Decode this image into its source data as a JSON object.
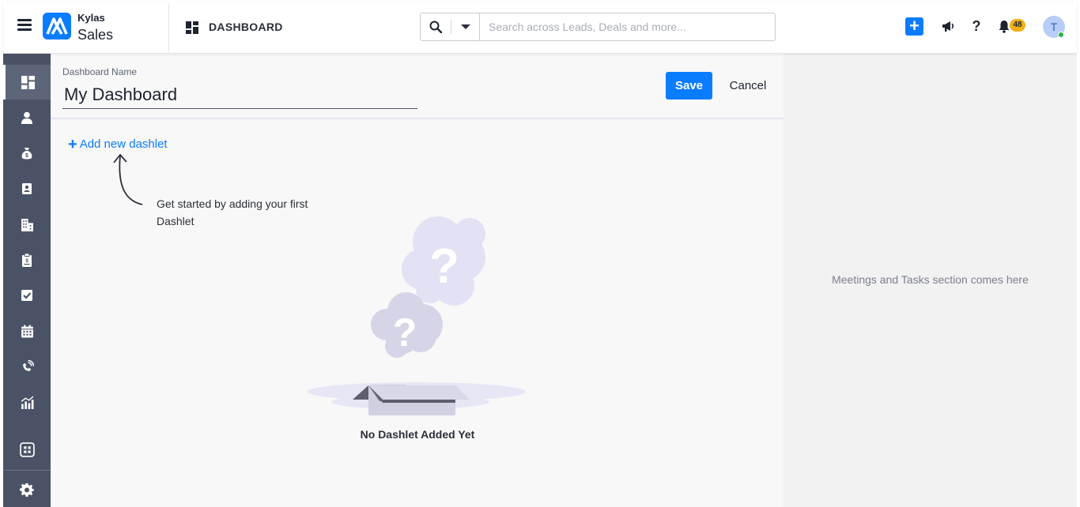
{
  "header": {
    "brand_top": "Kylas",
    "brand_bottom": "Sales",
    "page_title": "DASHBOARD",
    "search_placeholder": "Search across Leads, Deals and more...",
    "notifications_count": "48",
    "avatar_initial": "T",
    "help_label": "?"
  },
  "sidebar": {
    "items": [
      {
        "icon": "dashboard-icon"
      },
      {
        "icon": "contacts-person-icon"
      },
      {
        "icon": "money-bag-icon"
      },
      {
        "icon": "contact-card-icon"
      },
      {
        "icon": "company-building-icon"
      },
      {
        "icon": "deal-clipboard-icon"
      },
      {
        "icon": "task-checkbox-icon"
      },
      {
        "icon": "calendar-icon"
      },
      {
        "icon": "phone-call-icon"
      },
      {
        "icon": "reports-chart-icon"
      },
      {
        "icon": "apps-grid-icon"
      },
      {
        "icon": "settings-gear-icon"
      }
    ]
  },
  "editor": {
    "name_label": "Dashboard Name",
    "name_value": "My Dashboard",
    "save_label": "Save",
    "cancel_label": "Cancel",
    "add_dashlet_label": "Add new dashlet",
    "hint_text": "Get started by adding your first Dashlet",
    "empty_title": "No Dashlet Added Yet"
  },
  "right_panel": {
    "placeholder_text": "Meetings and Tasks section comes here"
  },
  "colors": {
    "accent": "#0a7cff",
    "sidebar_bg": "#4a5366",
    "badge": "#f2b11b",
    "online": "#26b34a"
  }
}
